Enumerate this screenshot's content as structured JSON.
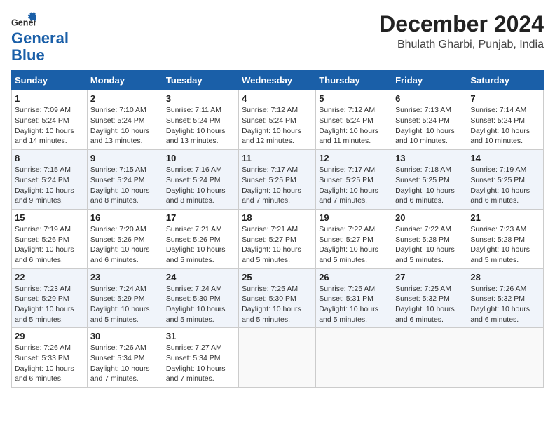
{
  "header": {
    "logo_line1": "General",
    "logo_line2": "Blue",
    "month": "December 2024",
    "location": "Bhulath Gharbi, Punjab, India"
  },
  "weekdays": [
    "Sunday",
    "Monday",
    "Tuesday",
    "Wednesday",
    "Thursday",
    "Friday",
    "Saturday"
  ],
  "weeks": [
    [
      {
        "day": "1",
        "info": "Sunrise: 7:09 AM\nSunset: 5:24 PM\nDaylight: 10 hours\nand 14 minutes."
      },
      {
        "day": "2",
        "info": "Sunrise: 7:10 AM\nSunset: 5:24 PM\nDaylight: 10 hours\nand 13 minutes."
      },
      {
        "day": "3",
        "info": "Sunrise: 7:11 AM\nSunset: 5:24 PM\nDaylight: 10 hours\nand 13 minutes."
      },
      {
        "day": "4",
        "info": "Sunrise: 7:12 AM\nSunset: 5:24 PM\nDaylight: 10 hours\nand 12 minutes."
      },
      {
        "day": "5",
        "info": "Sunrise: 7:12 AM\nSunset: 5:24 PM\nDaylight: 10 hours\nand 11 minutes."
      },
      {
        "day": "6",
        "info": "Sunrise: 7:13 AM\nSunset: 5:24 PM\nDaylight: 10 hours\nand 10 minutes."
      },
      {
        "day": "7",
        "info": "Sunrise: 7:14 AM\nSunset: 5:24 PM\nDaylight: 10 hours\nand 10 minutes."
      }
    ],
    [
      {
        "day": "8",
        "info": "Sunrise: 7:15 AM\nSunset: 5:24 PM\nDaylight: 10 hours\nand 9 minutes."
      },
      {
        "day": "9",
        "info": "Sunrise: 7:15 AM\nSunset: 5:24 PM\nDaylight: 10 hours\nand 8 minutes."
      },
      {
        "day": "10",
        "info": "Sunrise: 7:16 AM\nSunset: 5:24 PM\nDaylight: 10 hours\nand 8 minutes."
      },
      {
        "day": "11",
        "info": "Sunrise: 7:17 AM\nSunset: 5:25 PM\nDaylight: 10 hours\nand 7 minutes."
      },
      {
        "day": "12",
        "info": "Sunrise: 7:17 AM\nSunset: 5:25 PM\nDaylight: 10 hours\nand 7 minutes."
      },
      {
        "day": "13",
        "info": "Sunrise: 7:18 AM\nSunset: 5:25 PM\nDaylight: 10 hours\nand 6 minutes."
      },
      {
        "day": "14",
        "info": "Sunrise: 7:19 AM\nSunset: 5:25 PM\nDaylight: 10 hours\nand 6 minutes."
      }
    ],
    [
      {
        "day": "15",
        "info": "Sunrise: 7:19 AM\nSunset: 5:26 PM\nDaylight: 10 hours\nand 6 minutes."
      },
      {
        "day": "16",
        "info": "Sunrise: 7:20 AM\nSunset: 5:26 PM\nDaylight: 10 hours\nand 6 minutes."
      },
      {
        "day": "17",
        "info": "Sunrise: 7:21 AM\nSunset: 5:26 PM\nDaylight: 10 hours\nand 5 minutes."
      },
      {
        "day": "18",
        "info": "Sunrise: 7:21 AM\nSunset: 5:27 PM\nDaylight: 10 hours\nand 5 minutes."
      },
      {
        "day": "19",
        "info": "Sunrise: 7:22 AM\nSunset: 5:27 PM\nDaylight: 10 hours\nand 5 minutes."
      },
      {
        "day": "20",
        "info": "Sunrise: 7:22 AM\nSunset: 5:28 PM\nDaylight: 10 hours\nand 5 minutes."
      },
      {
        "day": "21",
        "info": "Sunrise: 7:23 AM\nSunset: 5:28 PM\nDaylight: 10 hours\nand 5 minutes."
      }
    ],
    [
      {
        "day": "22",
        "info": "Sunrise: 7:23 AM\nSunset: 5:29 PM\nDaylight: 10 hours\nand 5 minutes."
      },
      {
        "day": "23",
        "info": "Sunrise: 7:24 AM\nSunset: 5:29 PM\nDaylight: 10 hours\nand 5 minutes."
      },
      {
        "day": "24",
        "info": "Sunrise: 7:24 AM\nSunset: 5:30 PM\nDaylight: 10 hours\nand 5 minutes."
      },
      {
        "day": "25",
        "info": "Sunrise: 7:25 AM\nSunset: 5:30 PM\nDaylight: 10 hours\nand 5 minutes."
      },
      {
        "day": "26",
        "info": "Sunrise: 7:25 AM\nSunset: 5:31 PM\nDaylight: 10 hours\nand 5 minutes."
      },
      {
        "day": "27",
        "info": "Sunrise: 7:25 AM\nSunset: 5:32 PM\nDaylight: 10 hours\nand 6 minutes."
      },
      {
        "day": "28",
        "info": "Sunrise: 7:26 AM\nSunset: 5:32 PM\nDaylight: 10 hours\nand 6 minutes."
      }
    ],
    [
      {
        "day": "29",
        "info": "Sunrise: 7:26 AM\nSunset: 5:33 PM\nDaylight: 10 hours\nand 6 minutes."
      },
      {
        "day": "30",
        "info": "Sunrise: 7:26 AM\nSunset: 5:34 PM\nDaylight: 10 hours\nand 7 minutes."
      },
      {
        "day": "31",
        "info": "Sunrise: 7:27 AM\nSunset: 5:34 PM\nDaylight: 10 hours\nand 7 minutes."
      },
      null,
      null,
      null,
      null
    ]
  ]
}
